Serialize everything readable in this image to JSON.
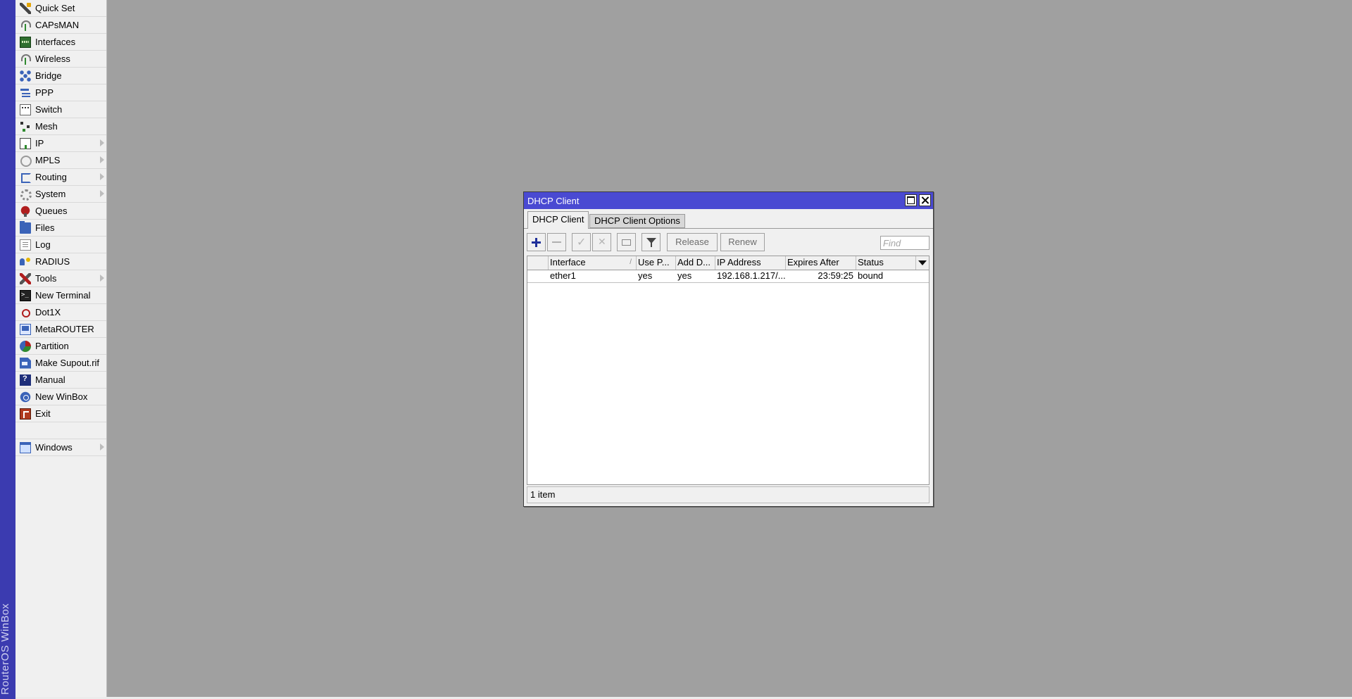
{
  "brand": {
    "text": "RouterOS WinBox"
  },
  "sidebar": {
    "items": [
      {
        "label": "Quick Set",
        "icon": "wand-icon",
        "submenu": false
      },
      {
        "label": "CAPsMAN",
        "icon": "antenna-icon",
        "submenu": false
      },
      {
        "label": "Interfaces",
        "icon": "network-card-icon",
        "submenu": false
      },
      {
        "label": "Wireless",
        "icon": "antenna-icon",
        "submenu": false
      },
      {
        "label": "Bridge",
        "icon": "bridge-icon",
        "submenu": false
      },
      {
        "label": "PPP",
        "icon": "ppp-icon",
        "submenu": false
      },
      {
        "label": "Switch",
        "icon": "switch-icon",
        "submenu": false
      },
      {
        "label": "Mesh",
        "icon": "mesh-icon",
        "submenu": false
      },
      {
        "label": "IP",
        "icon": "ip-icon",
        "submenu": true
      },
      {
        "label": "MPLS",
        "icon": "mpls-icon",
        "submenu": true
      },
      {
        "label": "Routing",
        "icon": "routing-icon",
        "submenu": true
      },
      {
        "label": "System",
        "icon": "gear-icon",
        "submenu": true
      },
      {
        "label": "Queues",
        "icon": "queues-icon",
        "submenu": false
      },
      {
        "label": "Files",
        "icon": "folder-icon",
        "submenu": false
      },
      {
        "label": "Log",
        "icon": "log-icon",
        "submenu": false
      },
      {
        "label": "RADIUS",
        "icon": "radius-icon",
        "submenu": false
      },
      {
        "label": "Tools",
        "icon": "tools-icon",
        "submenu": true
      },
      {
        "label": "New Terminal",
        "icon": "terminal-icon",
        "submenu": false
      },
      {
        "label": "Dot1X",
        "icon": "dot1x-icon",
        "submenu": false
      },
      {
        "label": "MetaROUTER",
        "icon": "metarouter-icon",
        "submenu": false
      },
      {
        "label": "Partition",
        "icon": "partition-icon",
        "submenu": false
      },
      {
        "label": "Make Supout.rif",
        "icon": "supout-icon",
        "submenu": false
      },
      {
        "label": "Manual",
        "icon": "manual-icon",
        "submenu": false
      },
      {
        "label": "New WinBox",
        "icon": "winbox-icon",
        "submenu": false
      },
      {
        "label": "Exit",
        "icon": "exit-icon",
        "submenu": false
      }
    ],
    "windows": {
      "label": "Windows",
      "icon": "windows-icon",
      "submenu": true
    }
  },
  "dhcp_window": {
    "title": "DHCP Client",
    "tabs": [
      {
        "label": "DHCP Client",
        "active": true
      },
      {
        "label": "DHCP Client Options",
        "active": false
      }
    ],
    "toolbar": {
      "release_label": "Release",
      "renew_label": "Renew",
      "find_placeholder": "Find"
    },
    "table": {
      "columns": [
        "",
        "Interface",
        "Use P...",
        "Add D...",
        "IP Address",
        "Expires After",
        "Status"
      ],
      "rows": [
        [
          "",
          "ether1",
          "yes",
          "yes",
          "192.168.1.217/...",
          "23:59:25",
          "bound"
        ]
      ]
    },
    "status": "1 item"
  },
  "colors": {
    "desktop": "#a0a0a0",
    "brand_strip": "#3b3bb0",
    "titlebar": "#4a4ad2",
    "panel": "#f0f0f0"
  }
}
